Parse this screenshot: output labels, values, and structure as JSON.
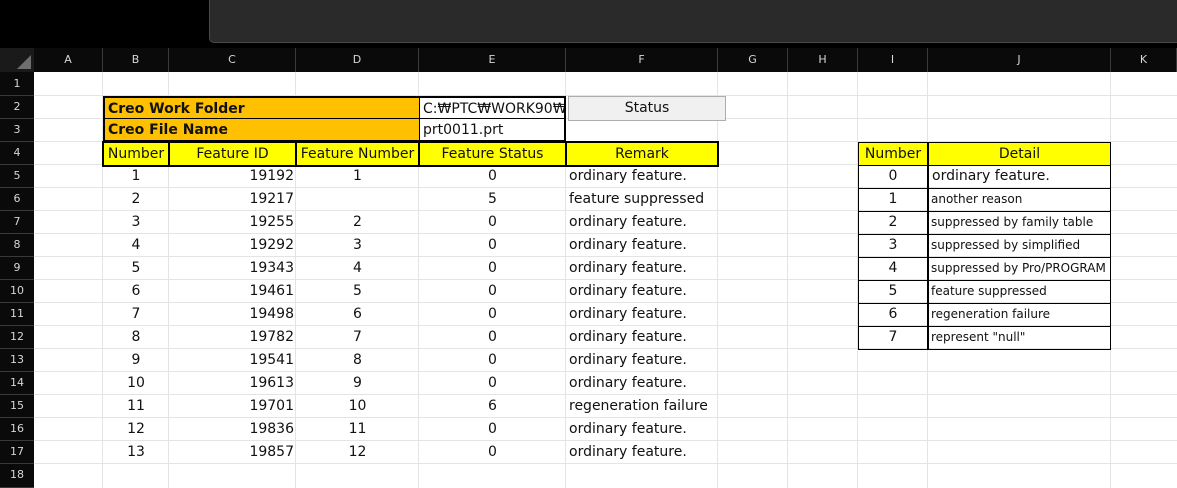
{
  "columns": [
    "A",
    "B",
    "C",
    "D",
    "E",
    "F",
    "G",
    "H",
    "I",
    "J",
    "K"
  ],
  "rows": [
    "1",
    "2",
    "3",
    "4",
    "5",
    "6",
    "7",
    "8",
    "9",
    "10",
    "11",
    "12",
    "13",
    "14",
    "15",
    "16",
    "17",
    "18"
  ],
  "info": {
    "work_folder_label": "Creo Work Folder",
    "work_folder_value": "C:₩PTC₩WORK90₩",
    "file_name_label": "Creo File Name",
    "file_name_value": "prt0011.prt",
    "status_button": "Status"
  },
  "main_table": {
    "headers": [
      "Number",
      "Feature ID",
      "Feature Number",
      "Feature Status",
      "Remark"
    ],
    "rows": [
      {
        "number": "1",
        "feature_id": "19192",
        "feature_number": "1",
        "status": "0",
        "remark": "ordinary feature."
      },
      {
        "number": "2",
        "feature_id": "19217",
        "feature_number": "",
        "status": "5",
        "remark": "feature suppressed"
      },
      {
        "number": "3",
        "feature_id": "19255",
        "feature_number": "2",
        "status": "0",
        "remark": "ordinary feature."
      },
      {
        "number": "4",
        "feature_id": "19292",
        "feature_number": "3",
        "status": "0",
        "remark": "ordinary feature."
      },
      {
        "number": "5",
        "feature_id": "19343",
        "feature_number": "4",
        "status": "0",
        "remark": "ordinary feature."
      },
      {
        "number": "6",
        "feature_id": "19461",
        "feature_number": "5",
        "status": "0",
        "remark": "ordinary feature."
      },
      {
        "number": "7",
        "feature_id": "19498",
        "feature_number": "6",
        "status": "0",
        "remark": "ordinary feature."
      },
      {
        "number": "8",
        "feature_id": "19782",
        "feature_number": "7",
        "status": "0",
        "remark": "ordinary feature."
      },
      {
        "number": "9",
        "feature_id": "19541",
        "feature_number": "8",
        "status": "0",
        "remark": "ordinary feature."
      },
      {
        "number": "10",
        "feature_id": "19613",
        "feature_number": "9",
        "status": "0",
        "remark": "ordinary feature."
      },
      {
        "number": "11",
        "feature_id": "19701",
        "feature_number": "10",
        "status": "6",
        "remark": "regeneration failure"
      },
      {
        "number": "12",
        "feature_id": "19836",
        "feature_number": "11",
        "status": "0",
        "remark": "ordinary feature."
      },
      {
        "number": "13",
        "feature_id": "19857",
        "feature_number": "12",
        "status": "0",
        "remark": "ordinary feature."
      }
    ]
  },
  "legend_table": {
    "headers": [
      "Number",
      "Detail"
    ],
    "rows": [
      {
        "number": "0",
        "detail": "ordinary feature."
      },
      {
        "number": "1",
        "detail": "another reason"
      },
      {
        "number": "2",
        "detail": "suppressed by family table"
      },
      {
        "number": "3",
        "detail": "suppressed by simplified"
      },
      {
        "number": "4",
        "detail": "suppressed by Pro/PROGRAM"
      },
      {
        "number": "5",
        "detail": "feature suppressed"
      },
      {
        "number": "6",
        "detail": "regeneration failure"
      },
      {
        "number": "7",
        "detail": "represent \"null\""
      }
    ]
  },
  "colors": {
    "header_orange": "#ffc000",
    "header_yellow": "#ffff00",
    "chrome_dark": "#0a0a0a"
  }
}
